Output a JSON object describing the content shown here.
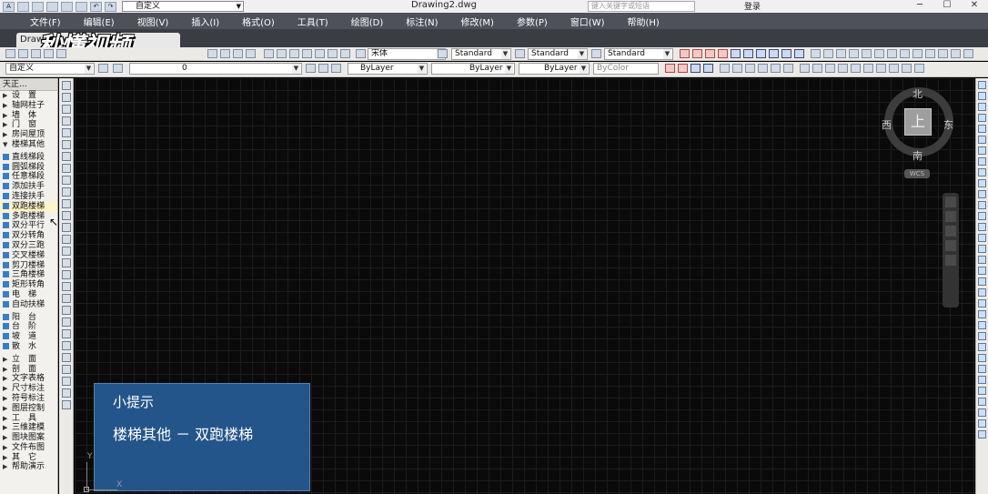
{
  "app": {
    "document_title": "Drawing2.dwg",
    "workspace": "自定义",
    "search_placeholder": "键入关键字或短语",
    "login_label": "登录",
    "minimize": "─",
    "maximize": "☐",
    "close": "✕"
  },
  "menu": [
    "文件(F)",
    "编辑(E)",
    "视图(V)",
    "插入(I)",
    "格式(O)",
    "工具(T)",
    "绘图(D)",
    "标注(N)",
    "修改(M)",
    "参数(P)",
    "窗口(W)",
    "帮助(H)"
  ],
  "doc_tab": {
    "label": "Draw"
  },
  "watermark": "秒懂视频",
  "toolbar2": {
    "font": "宋体",
    "text_style": "Standard",
    "dim_style": "Standard",
    "table_style": "Standard"
  },
  "toolbar3": {
    "workspace_combo": "自定义",
    "layer": "0",
    "color": "ByLayer",
    "linetype": "ByLayer",
    "lineweight": "ByLayer",
    "plot_style": "ByColor"
  },
  "left_panel": {
    "title": "天正...",
    "items": [
      {
        "label": "设　置",
        "kind": "tri"
      },
      {
        "label": "轴网柱子",
        "kind": "tri"
      },
      {
        "label": "墙　体",
        "kind": "tri"
      },
      {
        "label": "门　窗",
        "kind": "tri"
      },
      {
        "label": "房间屋顶",
        "kind": "tri"
      },
      {
        "label": "楼梯其他",
        "kind": "tri-open"
      },
      {
        "label": "直线梯段",
        "kind": "icon"
      },
      {
        "label": "圆弧梯段",
        "kind": "icon"
      },
      {
        "label": "任意梯段",
        "kind": "icon"
      },
      {
        "label": "添加扶手",
        "kind": "icon"
      },
      {
        "label": "连接扶手",
        "kind": "icon"
      },
      {
        "label": "双跑楼梯",
        "kind": "icon-hl"
      },
      {
        "label": "多跑楼梯",
        "kind": "icon"
      },
      {
        "label": "双分平行",
        "kind": "icon"
      },
      {
        "label": "双分转角",
        "kind": "icon"
      },
      {
        "label": "双分三跑",
        "kind": "icon"
      },
      {
        "label": "交叉楼梯",
        "kind": "icon"
      },
      {
        "label": "剪刀楼梯",
        "kind": "icon"
      },
      {
        "label": "三角楼梯",
        "kind": "icon"
      },
      {
        "label": "矩形转角",
        "kind": "icon"
      },
      {
        "label": "电　梯",
        "kind": "icon"
      },
      {
        "label": "自动扶梯",
        "kind": "icon"
      },
      {
        "label": "阳　台",
        "kind": "icon"
      },
      {
        "label": "台　阶",
        "kind": "icon"
      },
      {
        "label": "坡　道",
        "kind": "icon"
      },
      {
        "label": "散　水",
        "kind": "icon"
      },
      {
        "label": "立　面",
        "kind": "tri"
      },
      {
        "label": "剖　面",
        "kind": "tri"
      },
      {
        "label": "文字表格",
        "kind": "tri"
      },
      {
        "label": "尺寸标注",
        "kind": "tri"
      },
      {
        "label": "符号标注",
        "kind": "tri"
      },
      {
        "label": "图层控制",
        "kind": "tri"
      },
      {
        "label": "工　具",
        "kind": "tri"
      },
      {
        "label": "三维建模",
        "kind": "tri"
      },
      {
        "label": "图块图案",
        "kind": "tri"
      },
      {
        "label": "文件布图",
        "kind": "tri"
      },
      {
        "label": "其　它",
        "kind": "tri"
      },
      {
        "label": "帮助演示",
        "kind": "tri"
      }
    ]
  },
  "viewcube": {
    "top": "上",
    "north": "北",
    "south": "南",
    "east": "东",
    "west": "西",
    "wcs": "WCS"
  },
  "tip": {
    "title": "小提示",
    "body": "楼梯其他 － 双跑楼梯"
  },
  "ucs": {
    "x": "X",
    "y": "Y"
  },
  "colors": {
    "canvas": "#0a0a0a",
    "menubar": "#4e5158",
    "tip_bg": "#24558a",
    "highlight": "#fff4c8"
  }
}
